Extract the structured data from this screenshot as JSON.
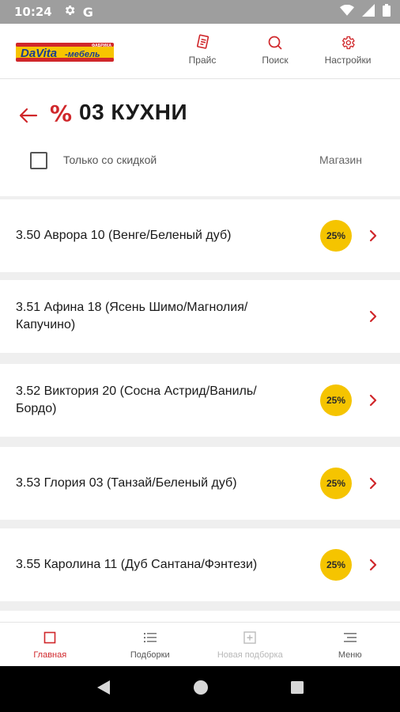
{
  "status_bar": {
    "time": "10:24",
    "g_letter": "G"
  },
  "logo": {
    "brand": "DaVita",
    "suffix": "-мебель",
    "tag": "ФАБРИКА"
  },
  "top_actions": [
    {
      "label": "Прайс",
      "icon": "price-list-icon"
    },
    {
      "label": "Поиск",
      "icon": "search-icon"
    },
    {
      "label": "Настройки",
      "icon": "gear-icon"
    }
  ],
  "header": {
    "percent_symbol": "%",
    "title": "03 КУХНИ",
    "discount_filter_label": "Только со скидкой",
    "discount_filter_checked": false,
    "store_label": "Магазин"
  },
  "items": [
    {
      "name": "3.50 Аврора 10 (Венге/Беленый дуб)",
      "discount": "25%"
    },
    {
      "name": "3.51 Афина 18 (Ясень Шимо/Магнолия/ Капучино)",
      "discount": ""
    },
    {
      "name": "3.52 Виктория 20 (Сосна Астрид/Ваниль/ Бордо)",
      "discount": "25%"
    },
    {
      "name": "3.53 Глория 03 (Танзай/Беленый дуб)",
      "discount": "25%"
    },
    {
      "name": "3.55 Каролина 11 (Дуб Сантана/Фэнтези)",
      "discount": "25%"
    }
  ],
  "bottom_nav": [
    {
      "label": "Главная",
      "state": "active",
      "icon": "home-icon"
    },
    {
      "label": "Подборки",
      "state": "normal",
      "icon": "list-icon"
    },
    {
      "label": "Новая подборка",
      "state": "disabled",
      "icon": "add-box-icon"
    },
    {
      "label": "Меню",
      "state": "normal",
      "icon": "menu-icon"
    }
  ],
  "colors": {
    "accent": "#d0272b",
    "badge": "#f5c400",
    "status_bar": "#9e9e9e"
  }
}
